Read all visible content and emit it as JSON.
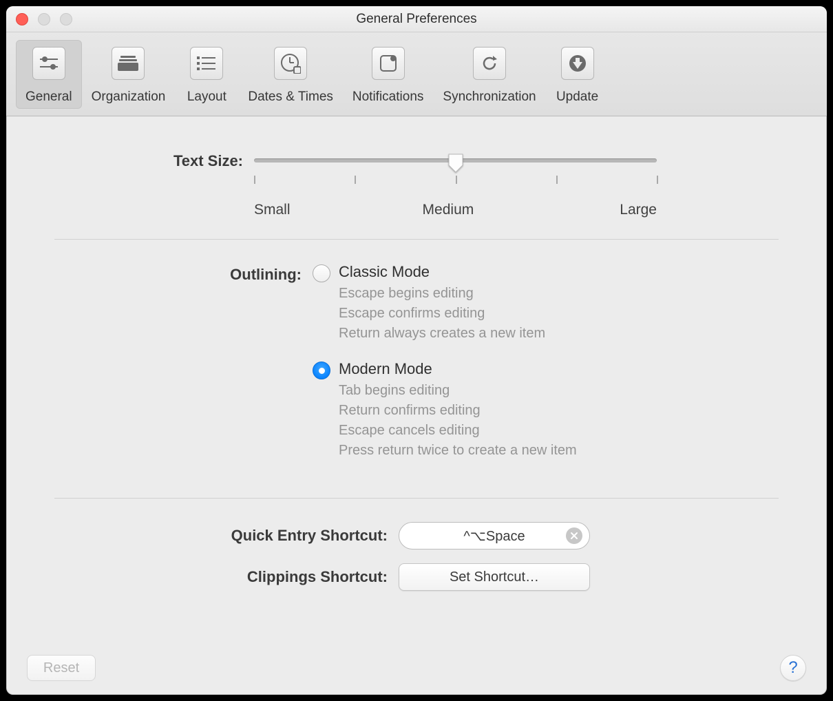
{
  "window": {
    "title": "General Preferences"
  },
  "toolbar": {
    "tabs": [
      {
        "id": "general",
        "label": "General",
        "active": true
      },
      {
        "id": "organization",
        "label": "Organization",
        "active": false
      },
      {
        "id": "layout",
        "label": "Layout",
        "active": false
      },
      {
        "id": "dates",
        "label": "Dates & Times",
        "active": false
      },
      {
        "id": "notifications",
        "label": "Notifications",
        "active": false
      },
      {
        "id": "sync",
        "label": "Synchronization",
        "active": false
      },
      {
        "id": "update",
        "label": "Update",
        "active": false
      }
    ]
  },
  "textSize": {
    "label": "Text Size:",
    "min_label": "Small",
    "mid_label": "Medium",
    "max_label": "Large",
    "value": 2,
    "steps": 5
  },
  "outlining": {
    "label": "Outlining:",
    "options": [
      {
        "id": "classic",
        "title": "Classic Mode",
        "desc_lines": [
          "Escape begins editing",
          "Escape confirms editing",
          "Return always creates a new item"
        ],
        "checked": false
      },
      {
        "id": "modern",
        "title": "Modern Mode",
        "desc_lines": [
          "Tab begins editing",
          "Return confirms editing",
          "Escape cancels editing",
          "Press return twice to create a new item"
        ],
        "checked": true
      }
    ]
  },
  "shortcuts": {
    "quick_label": "Quick Entry Shortcut:",
    "quick_value": "^⌥Space",
    "clip_label": "Clippings Shortcut:",
    "clip_button": "Set Shortcut…"
  },
  "footer": {
    "reset": "Reset",
    "help": "?"
  }
}
